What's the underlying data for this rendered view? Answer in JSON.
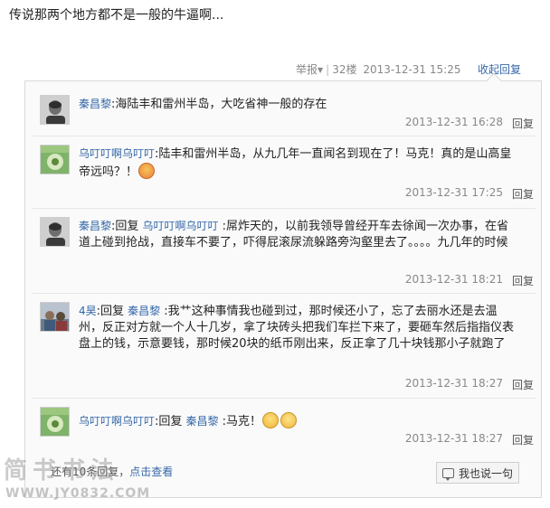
{
  "post": {
    "text": "传说那两个地方都不是一般的牛逼啊..."
  },
  "meta": {
    "report": "举报",
    "floor": "32楼",
    "timestamp": "2013-12-31 15:25",
    "collapse_label": "收起回复"
  },
  "comments": [
    {
      "user": "秦昌黎",
      "text": ":海陆丰和雷州半岛，大吃省神一般的存在",
      "time": "2013-12-31 16:28",
      "reply_label": "回复",
      "avatar": "man-avatar"
    },
    {
      "user": "乌叮叮啊乌叮叮",
      "text": ":陆丰和雷州半岛，从九几年一直闻名到现在了！马克！真的是山高皇帝远吗？！",
      "emoji": "angry-emoji",
      "time": "2013-12-31 17:25",
      "reply_label": "回复",
      "avatar": "flower-avatar"
    },
    {
      "user": "秦昌黎",
      "reply_prefix": ":回复 ",
      "reply_to": "乌叮叮啊乌叮叮",
      "text": " :屌炸天的，以前我领导曾经开车去徐闻一次办事，在省道上碰到抢战，直接车不要了，吓得屁滚尿流躲路旁沟壑里去了。。。。九几年的时候",
      "time": "2013-12-31 18:21",
      "reply_label": "回复",
      "avatar": "man-avatar"
    },
    {
      "user": "4昊",
      "reply_prefix": ":回复 ",
      "reply_to": "秦昌黎",
      "text": " :我艹这种事情我也碰到过，那时候还小了，忘了去丽水还是去温州，反正对方就一个人十几岁，拿了块砖头把我们车拦下来了，要砸车然后指指仪表盘上的钱，示意要钱，那时候20块的纸币刚出来，反正拿了几十块钱那小子就跑了",
      "time": "2013-12-31 18:27",
      "reply_label": "回复",
      "avatar": "photo-avatar"
    },
    {
      "user": "乌叮叮啊乌叮叮",
      "reply_prefix": ":回复 ",
      "reply_to": "秦昌黎",
      "text": " :马克！",
      "emoji": "shy-emoji",
      "emoji2": "sleepy-emoji",
      "time": "2013-12-31 18:27",
      "reply_label": "回复",
      "avatar": "flower-avatar"
    }
  ],
  "footer": {
    "more_prefix": "还有10条回复，",
    "more_link": "点击查看",
    "say_label": "我也说一句"
  },
  "watermark": {
    "brand": "简书书法",
    "url": "WWW.JY0832.COM"
  }
}
